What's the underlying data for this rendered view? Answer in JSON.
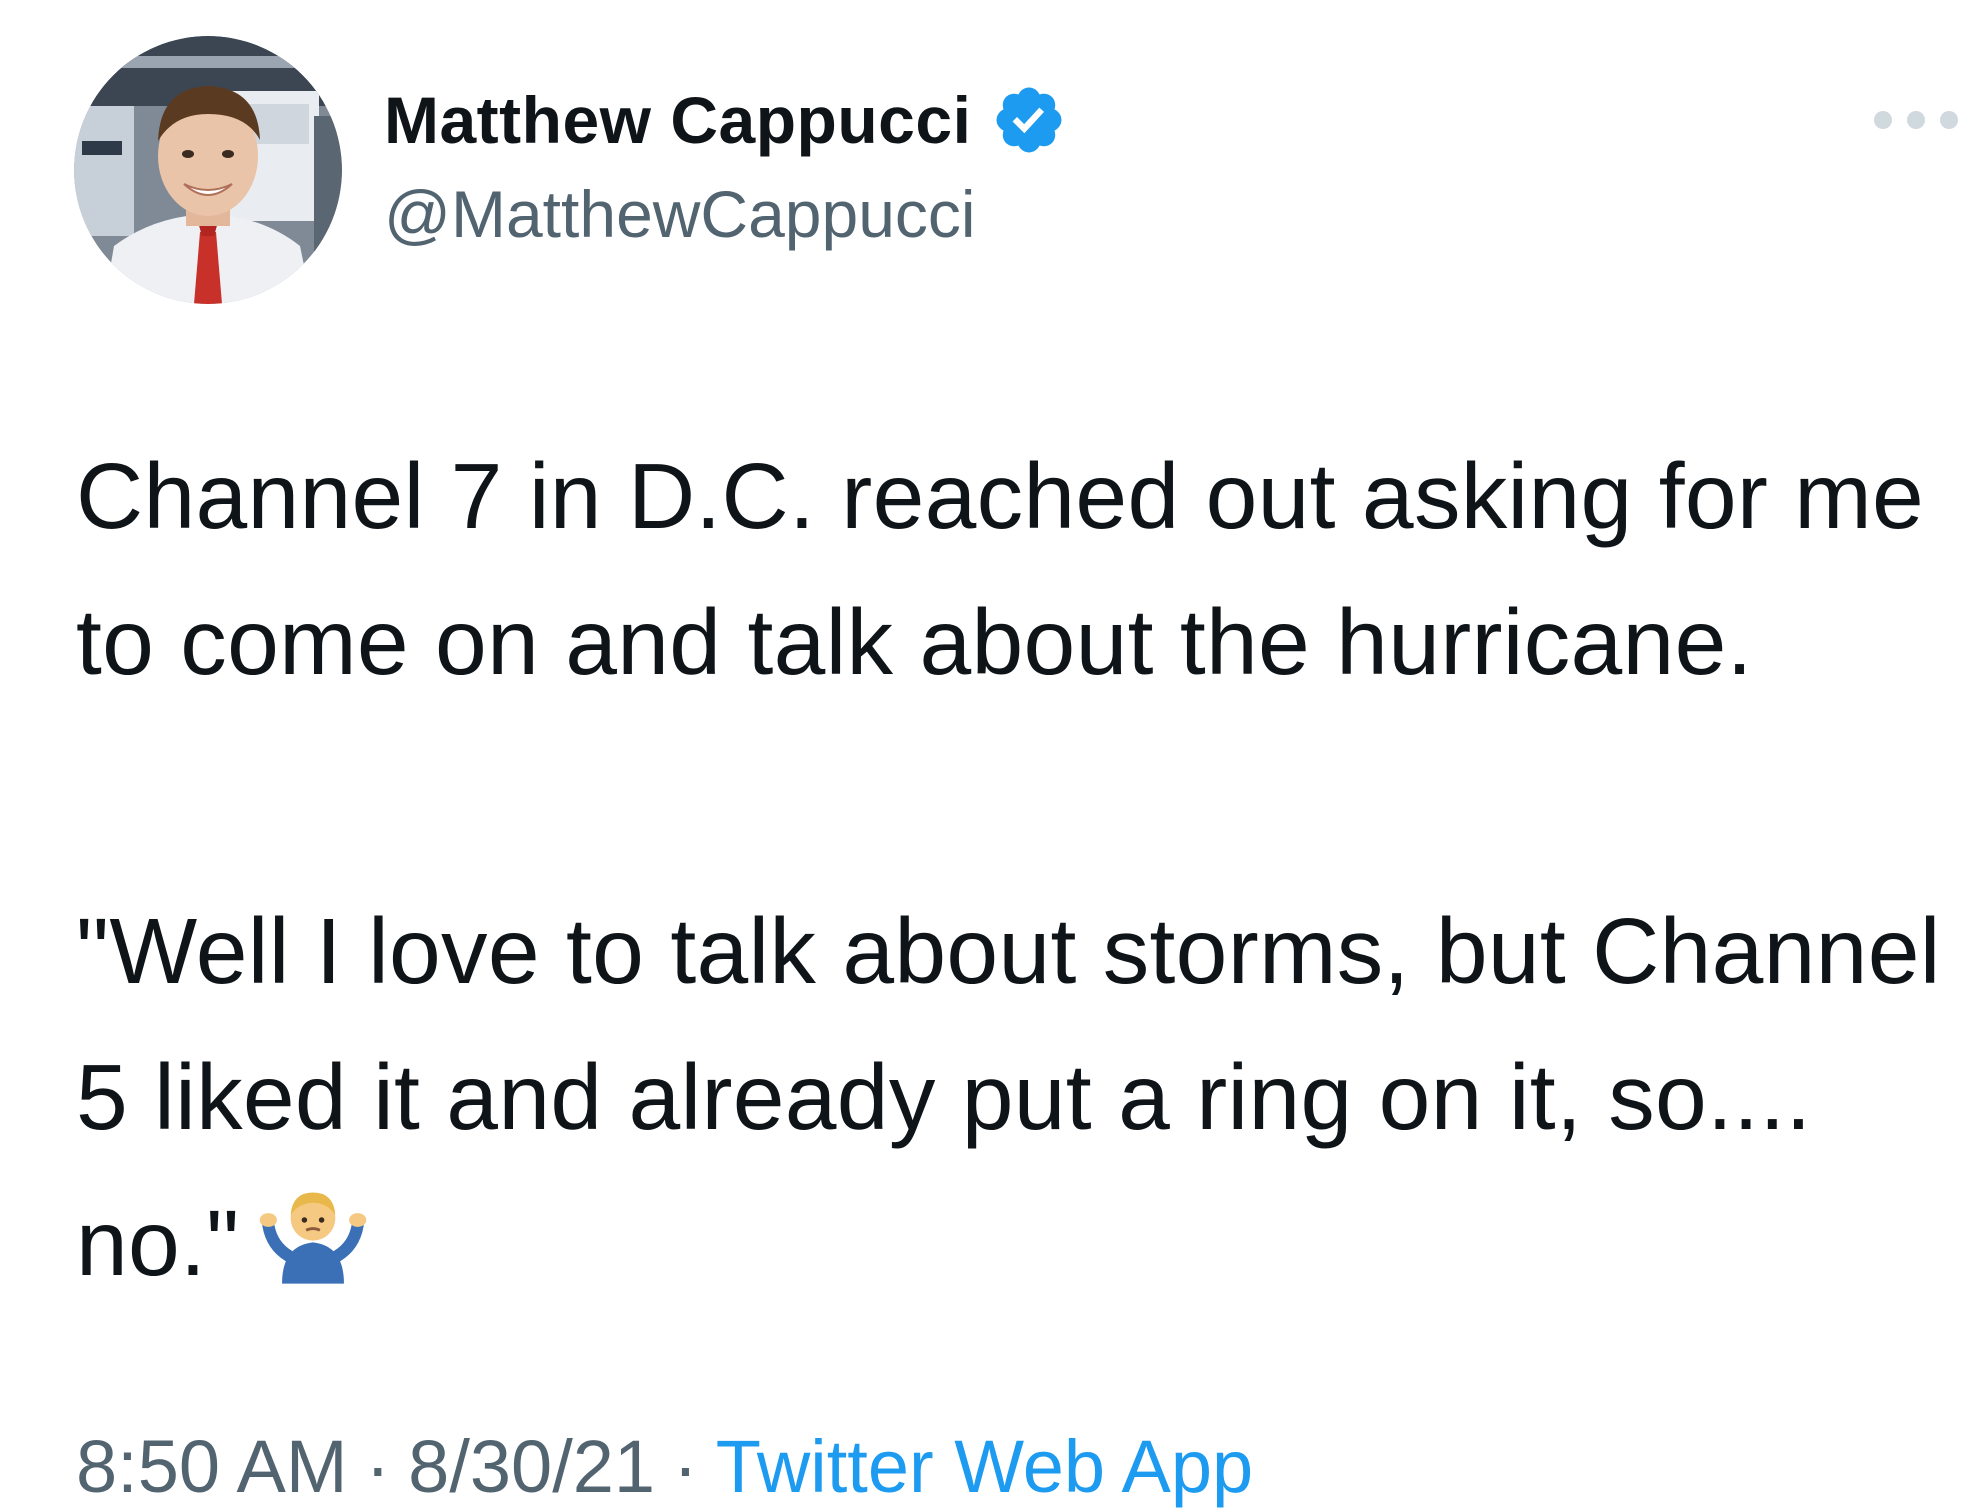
{
  "author": {
    "display_name": "Matthew Cappucci",
    "handle": "@MatthewCappucci",
    "verified": true,
    "avatar_icon": "avatar-photo",
    "verified_icon": "verified-badge-icon",
    "more_icon": "more-options-icon"
  },
  "tweet": {
    "paragraphs": [
      "Channel 7 in D.C. reached out asking for me to come on and talk about the hurricane.",
      "\"Well I love to talk about storms, but Channel 5 liked it and already put a ring on it, so.... no.\""
    ],
    "emoji": "person-shrugging-emoji"
  },
  "meta": {
    "time": "8:50 AM",
    "separator": "·",
    "date": "8/30/21",
    "source": "Twitter Web App"
  },
  "colors": {
    "text_primary": "#0f1419",
    "text_secondary": "#536471",
    "link_blue": "#1d9bf0",
    "verified_blue": "#1d9bf0"
  }
}
